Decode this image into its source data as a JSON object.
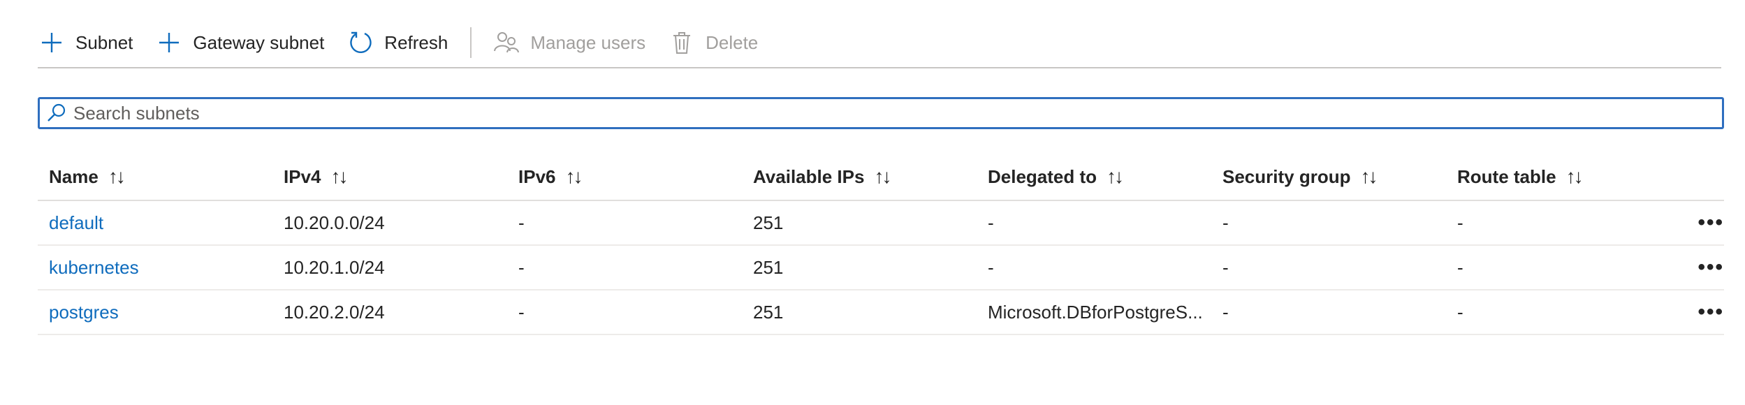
{
  "toolbar": {
    "subnet_label": "Subnet",
    "gateway_subnet_label": "Gateway subnet",
    "refresh_label": "Refresh",
    "manage_users_label": "Manage users",
    "delete_label": "Delete"
  },
  "search": {
    "placeholder": "Search subnets",
    "value": ""
  },
  "table": {
    "columns": [
      "Name",
      "IPv4",
      "IPv6",
      "Available IPs",
      "Delegated to",
      "Security group",
      "Route table"
    ],
    "sort_glyph": "↑↓",
    "more_glyph": "•••",
    "rows": [
      {
        "name": "default",
        "ipv4": "10.20.0.0/24",
        "ipv6": "-",
        "available_ips": "251",
        "delegated_to": "-",
        "security_group": "-",
        "route_table": "-"
      },
      {
        "name": "kubernetes",
        "ipv4": "10.20.1.0/24",
        "ipv6": "-",
        "available_ips": "251",
        "delegated_to": "-",
        "security_group": "-",
        "route_table": "-"
      },
      {
        "name": "postgres",
        "ipv4": "10.20.2.0/24",
        "ipv6": "-",
        "available_ips": "251",
        "delegated_to": "Microsoft.DBforPostgreS...",
        "security_group": "-",
        "route_table": "-"
      }
    ]
  },
  "colors": {
    "accent": "#0f6cbd",
    "search_border": "#2f6fbf",
    "disabled": "#a19f9d",
    "divider": "#c8c6c4"
  },
  "icons": {
    "add": "plus-icon",
    "refresh": "refresh-icon",
    "manage_users": "people-icon",
    "delete": "trash-icon",
    "search": "search-icon"
  }
}
